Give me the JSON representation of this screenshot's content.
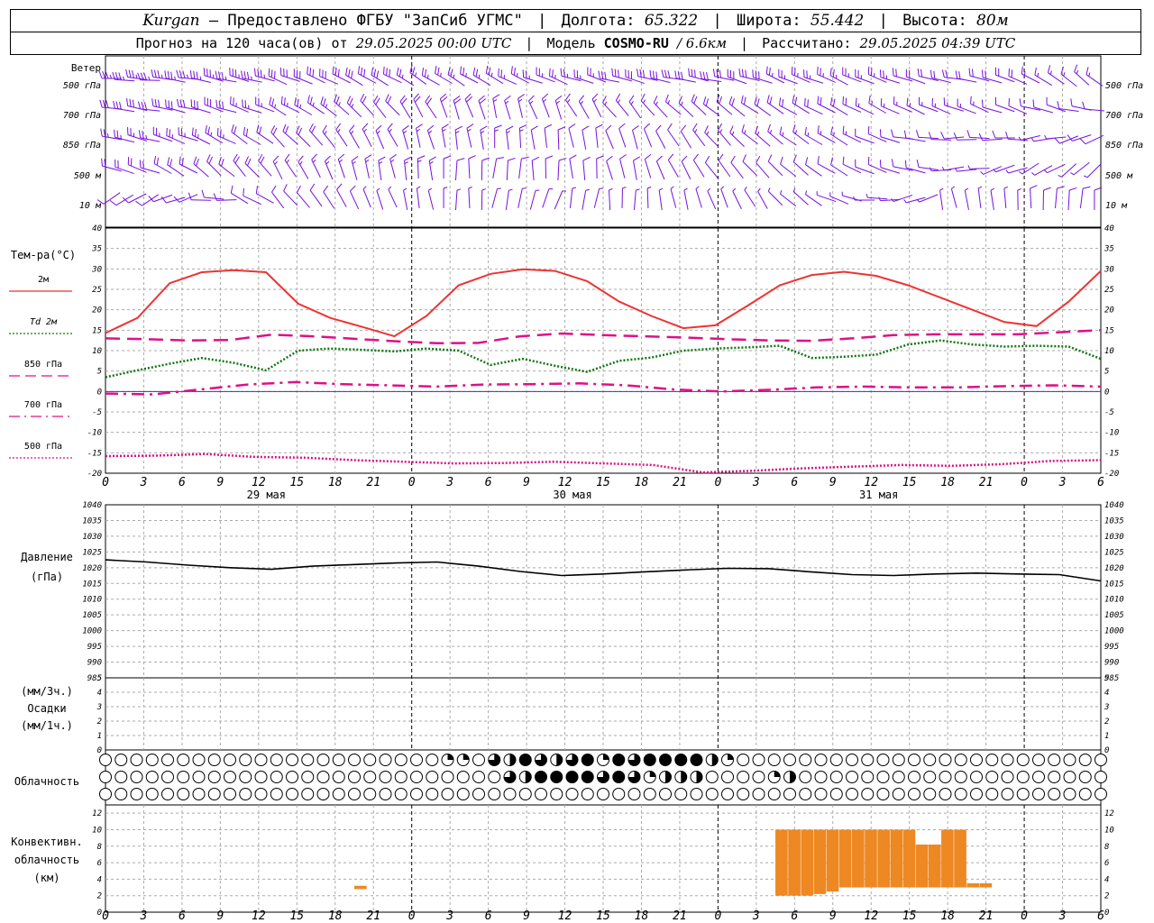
{
  "header": {
    "station": "Kurgan",
    "provider": "— Предоставлено ФГБУ \"ЗапСиб УГМС\"",
    "lon_label": "Долгота:",
    "lon_value": "65.322",
    "lat_label": "Широта:",
    "lat_value": "55.442",
    "alt_label": "Высота:",
    "alt_value": "80м",
    "forecast_label": "Прогноз на 120 часа(ов) от",
    "forecast_start": "29.05.2025 00:00 UTC",
    "model_label": "Модель",
    "model_name": "COSMO-RU",
    "model_res": "/ 6.6км",
    "calc_label": "Рассчитано:",
    "calc_time": "29.05.2025 04:39 UTC"
  },
  "colors": {
    "t2m": "#ee3333",
    "td2m": "#117711",
    "t850": "#dd1188",
    "t700": "#dd1188",
    "t500": "#dd1188",
    "zero_line": "#3333cc",
    "wind": "#7711dd",
    "pressure": "#000000",
    "convective": "#ee8822",
    "grid": "#aaaaaa"
  },
  "time_axis": {
    "hours": [
      0,
      3,
      6,
      9,
      12,
      15,
      18,
      21,
      0,
      3,
      6,
      9,
      12,
      15,
      18,
      21,
      0,
      3,
      6,
      9,
      12,
      15,
      18,
      21,
      0,
      3,
      6
    ],
    "day_labels": [
      {
        "hour_index": 4,
        "label": "29 мая"
      },
      {
        "hour_index": 12,
        "label": "30 мая"
      },
      {
        "hour_index": 20,
        "label": "31 мая"
      }
    ]
  },
  "wind_panel": {
    "title": "Ветер",
    "levels": [
      "500 гПа",
      "700 гПа",
      "850 гПа",
      "500 м",
      "10  м"
    ],
    "levels_right": [
      "500 гПа",
      "700 гПа",
      "850 гПа",
      "500 м",
      "10  м"
    ],
    "barbs": [
      {
        "dir": [
          275,
          278,
          282,
          286,
          292,
          296,
          300,
          303,
          300,
          296,
          292,
          288,
          284,
          282,
          282,
          286,
          292,
          295,
          290,
          285,
          282,
          290,
          300,
          310
        ],
        "spd": [
          35,
          35,
          35,
          35,
          30,
          30,
          30,
          25,
          25,
          25,
          25,
          25,
          30,
          30,
          30,
          30,
          25,
          25,
          25,
          20,
          20,
          20,
          15,
          15
        ]
      },
      {
        "dir": [
          280,
          282,
          286,
          292,
          300,
          310,
          320,
          330,
          340,
          345,
          340,
          330,
          320,
          315,
          310,
          305,
          300,
          298,
          296,
          292,
          292,
          290,
          285,
          280
        ],
        "spd": [
          30,
          30,
          30,
          25,
          25,
          25,
          20,
          20,
          20,
          15,
          15,
          15,
          15,
          15,
          20,
          20,
          20,
          20,
          15,
          15,
          15,
          10,
          10,
          10
        ]
      },
      {
        "dir": [
          285,
          290,
          296,
          305,
          315,
          325,
          335,
          345,
          350,
          355,
          355,
          350,
          340,
          330,
          320,
          310,
          305,
          300,
          290,
          275,
          270,
          270,
          260,
          250
        ],
        "spd": [
          25,
          25,
          25,
          20,
          20,
          15,
          15,
          15,
          15,
          15,
          10,
          10,
          10,
          10,
          15,
          15,
          15,
          15,
          10,
          10,
          10,
          10,
          5,
          10
        ]
      },
      {
        "dir": [
          290,
          300,
          310,
          320,
          330,
          340,
          350,
          355,
          0,
          5,
          0,
          355,
          345,
          335,
          325,
          318,
          310,
          300,
          290,
          280,
          265,
          250,
          240,
          230
        ],
        "spd": [
          20,
          20,
          20,
          20,
          15,
          15,
          15,
          15,
          10,
          10,
          10,
          10,
          10,
          10,
          10,
          10,
          10,
          10,
          10,
          10,
          5,
          5,
          5,
          5
        ]
      },
      {
        "dir": [
          240,
          250,
          270,
          300,
          320,
          330,
          340,
          350,
          0,
          10,
          20,
          10,
          0,
          350,
          340,
          330,
          310,
          290,
          270,
          250,
          350,
          355,
          0,
          5
        ],
        "spd": [
          10,
          10,
          10,
          10,
          10,
          10,
          5,
          5,
          5,
          5,
          5,
          5,
          5,
          5,
          5,
          5,
          5,
          5,
          5,
          5,
          5,
          5,
          10,
          10
        ]
      }
    ]
  },
  "temp_panel": {
    "title": "Тем-ра(°C)",
    "legend": [
      {
        "label": "2м",
        "style": "solid",
        "color_key": "t2m"
      },
      {
        "label": "Td 2м",
        "style": "dotted",
        "color_key": "td2m"
      },
      {
        "label": "850 гПа",
        "style": "dashed",
        "color_key": "t850"
      },
      {
        "label": "700 гПа",
        "style": "dashdot",
        "color_key": "t700"
      },
      {
        "label": "500 гПа",
        "style": "dotted",
        "color_key": "t500"
      }
    ],
    "yticks": [
      40,
      35,
      30,
      25,
      20,
      15,
      10,
      5,
      0,
      -5,
      -10,
      -15,
      -20
    ],
    "ylim": [
      -20,
      40
    ]
  },
  "pressure_panel": {
    "title": "Давление",
    "unit": "(гПа)",
    "yticks": [
      1040,
      1035,
      1030,
      1025,
      1020,
      1015,
      1010,
      1005,
      1000,
      995,
      990,
      985
    ],
    "ylim": [
      985,
      1040
    ]
  },
  "precip_panel": {
    "unit_3h": "(мм/3ч.)",
    "title": "Осадки",
    "unit_1h": "(мм/1ч.)",
    "yticks": [
      5,
      4,
      3,
      2,
      1,
      0
    ],
    "ylim": [
      0,
      5
    ]
  },
  "cloud_panel": {
    "title": "Облачность",
    "rows": [
      {
        "fraction": [
          0,
          0,
          0,
          0,
          0,
          0,
          0,
          0,
          0,
          0,
          0,
          0,
          0,
          0,
          0,
          0,
          0,
          0,
          0,
          0,
          0,
          0,
          0,
          0,
          0,
          0,
          0,
          0,
          0,
          0,
          0,
          0,
          0,
          0,
          0,
          0,
          0,
          0,
          0,
          0,
          0,
          0,
          0,
          0,
          0,
          0,
          0.5,
          0.25,
          0.25,
          0.25,
          0,
          0,
          0.5,
          0.75,
          0.25,
          0.5,
          0.5,
          0.75,
          1,
          1,
          0.75,
          0.75,
          0.5,
          1,
          0.75,
          1,
          1,
          1,
          0.25,
          1,
          1,
          1,
          1,
          0.75,
          1,
          1,
          1,
          1,
          1,
          1,
          1,
          1,
          0.25,
          0.75,
          0.5,
          0.75,
          0.25,
          0,
          0,
          0,
          0,
          0,
          0,
          0,
          0,
          0,
          0,
          0,
          0,
          0,
          0,
          0,
          0,
          0,
          0,
          0,
          0,
          0,
          0,
          0,
          0,
          0,
          0,
          0,
          0,
          0,
          0,
          0,
          0,
          0,
          0,
          0,
          0,
          0,
          0,
          0,
          0,
          0,
          0,
          0,
          0,
          0,
          0,
          0,
          0,
          0,
          0,
          0,
          0,
          0
        ]
      },
      {
        "fraction": [
          0,
          0,
          0,
          0,
          0,
          0,
          0,
          0,
          0,
          0,
          0,
          0,
          0,
          0,
          0,
          0,
          0,
          0,
          0,
          0,
          0,
          0,
          0,
          0,
          0,
          0,
          0,
          0,
          0,
          0,
          0,
          0,
          0,
          0,
          0,
          0,
          0,
          0,
          0,
          0,
          0,
          0,
          0,
          0,
          0,
          0,
          0,
          0,
          0,
          0,
          0,
          0,
          0,
          0,
          0,
          0,
          0.75,
          0.75,
          0.5,
          0.75,
          1,
          1,
          1,
          1,
          1,
          1,
          1,
          1,
          0.75,
          1,
          1,
          1,
          0.75,
          0.75,
          0.5,
          0.25,
          0.25,
          0.5,
          0.75,
          0.5,
          0.25,
          0.5,
          0,
          0,
          0,
          0,
          0,
          0,
          0,
          0,
          0,
          0.25,
          0.25,
          0.25,
          0.5,
          0,
          0,
          0,
          0,
          0,
          0,
          0,
          0,
          0,
          0,
          0,
          0,
          0,
          0,
          0,
          0,
          0,
          0,
          0,
          0,
          0,
          0,
          0,
          0,
          0,
          0,
          0,
          0,
          0,
          0,
          0,
          0,
          0,
          0,
          0,
          0,
          0,
          0,
          0,
          0,
          0,
          0,
          0,
          0,
          0
        ]
      },
      {
        "fraction": [
          0,
          0,
          0,
          0,
          0,
          0,
          0,
          0,
          0,
          0,
          0,
          0,
          0,
          0,
          0,
          0,
          0,
          0,
          0,
          0,
          0,
          0,
          0,
          0,
          0,
          0,
          0,
          0,
          0,
          0,
          0,
          0,
          0,
          0,
          0,
          0,
          0,
          0,
          0,
          0,
          0,
          0,
          0,
          0,
          0,
          0,
          0,
          0,
          0,
          0,
          0,
          0,
          0,
          0,
          0,
          0,
          0,
          0,
          0,
          0,
          0,
          0,
          0,
          0,
          0,
          0,
          0,
          0,
          0,
          0,
          0,
          0,
          0,
          0,
          0,
          0,
          0,
          0,
          0,
          0,
          0,
          0,
          0,
          0,
          0,
          0,
          0,
          0,
          0,
          0,
          0,
          0,
          0,
          0,
          0,
          0,
          0,
          0,
          0,
          0,
          0,
          0,
          0,
          0,
          0,
          0,
          0,
          0,
          0,
          0,
          0,
          0,
          0,
          0,
          0,
          0,
          0,
          0,
          0,
          0,
          0,
          0,
          0,
          0,
          0,
          0,
          0,
          0,
          0,
          0,
          0
        ]
      }
    ]
  },
  "conv_panel": {
    "title_1": "Конвективн.",
    "title_2": "облачность",
    "title_3": "(км)",
    "yticks": [
      12,
      10,
      8,
      6,
      4,
      2,
      0
    ],
    "ylim": [
      0,
      13
    ]
  },
  "chart_data": {
    "type": "line",
    "x_hours": [
      0,
      3,
      6,
      9,
      12,
      15,
      18,
      21,
      24,
      27,
      30,
      33,
      36,
      39,
      42,
      45,
      48,
      51,
      54,
      57,
      60,
      63,
      66,
      69,
      72,
      75,
      78
    ],
    "series": [
      {
        "name": "2м",
        "values": [
          14.3,
          18.0,
          26.5,
          29.2,
          29.7,
          29.2,
          21.5,
          18.0,
          15.8,
          13.5,
          18.5,
          26.0,
          28.8,
          29.9,
          29.5,
          27.0,
          22.0,
          18.5,
          15.5,
          16.2,
          21.0,
          26.0,
          28.5,
          29.3,
          28.3,
          26.0,
          23.0,
          20.0,
          17.0,
          16.0,
          22.0,
          29.5
        ]
      },
      {
        "name": "Td 2м",
        "values": [
          3.5,
          5.2,
          6.8,
          8.2,
          7.0,
          5.2,
          10.0,
          10.5,
          10.2,
          9.8,
          10.5,
          10.0,
          6.5,
          8.0,
          6.3,
          4.8,
          7.5,
          8.3,
          10.0,
          10.5,
          10.8,
          11.2,
          8.2,
          8.5,
          9.0,
          11.5,
          12.5,
          11.5,
          11.0,
          11.2,
          11.0,
          8.0
        ]
      },
      {
        "name": "850 гПа",
        "values": [
          13.0,
          12.8,
          12.5,
          12.6,
          13.9,
          13.5,
          12.9,
          12.3,
          11.8,
          11.9,
          13.5,
          14.2,
          13.8,
          13.5,
          13.2,
          12.8,
          12.5,
          12.4,
          13.0,
          13.8,
          14.0,
          14.0,
          14.0,
          14.5,
          15.0
        ]
      },
      {
        "name": "700 гПа",
        "values": [
          -0.5,
          -0.7,
          0.5,
          1.7,
          2.3,
          1.8,
          1.5,
          1.2,
          1.7,
          1.8,
          2.0,
          1.5,
          0.5,
          0.0,
          0.4,
          1.0,
          1.2,
          1.0,
          1.0,
          1.3,
          1.5,
          1.2
        ]
      },
      {
        "name": "500 гПа",
        "values": [
          -15.8,
          -15.7,
          -15.3,
          -16.0,
          -16.2,
          -16.8,
          -17.2,
          -17.6,
          -17.5,
          -17.2,
          -17.6,
          -18.0,
          -19.8,
          -19.4,
          -18.8,
          -18.4,
          -18.0,
          -18.2,
          -17.8,
          -17.0,
          -16.8
        ]
      },
      {
        "name": "Давление",
        "values": [
          1022.5,
          1021.8,
          1020.8,
          1020.0,
          1019.5,
          1020.5,
          1021.0,
          1021.5,
          1021.8,
          1020.5,
          1018.8,
          1017.5,
          1018.0,
          1018.7,
          1019.3,
          1019.8,
          1019.7,
          1018.7,
          1017.8,
          1017.5,
          1018.0,
          1018.3,
          1018.0,
          1017.8,
          1015.8
        ]
      }
    ],
    "convective": [
      {
        "hour_start": 19.5,
        "hour_end": 20.5,
        "base_km": 2.8,
        "top_km": 3.2
      },
      {
        "hour_start": 52.5,
        "hour_end": 53.5,
        "base_km": 2.0,
        "top_km": 10.0
      },
      {
        "hour_start": 53.5,
        "hour_end": 54.5,
        "base_km": 2.0,
        "top_km": 10.0
      },
      {
        "hour_start": 54.5,
        "hour_end": 55.5,
        "base_km": 2.0,
        "top_km": 10.0
      },
      {
        "hour_start": 55.5,
        "hour_end": 56.5,
        "base_km": 2.2,
        "top_km": 10.0
      },
      {
        "hour_start": 56.5,
        "hour_end": 57.5,
        "base_km": 2.5,
        "top_km": 10.0
      },
      {
        "hour_start": 57.5,
        "hour_end": 58.5,
        "base_km": 3.0,
        "top_km": 10.0
      },
      {
        "hour_start": 58.5,
        "hour_end": 59.5,
        "base_km": 3.0,
        "top_km": 10.0
      },
      {
        "hour_start": 59.5,
        "hour_end": 60.5,
        "base_km": 3.0,
        "top_km": 10.0
      },
      {
        "hour_start": 60.5,
        "hour_end": 61.5,
        "base_km": 3.0,
        "top_km": 10.0
      },
      {
        "hour_start": 61.5,
        "hour_end": 62.5,
        "base_km": 3.0,
        "top_km": 10.0
      },
      {
        "hour_start": 62.5,
        "hour_end": 63.5,
        "base_km": 3.0,
        "top_km": 10.0
      },
      {
        "hour_start": 63.5,
        "hour_end": 64.5,
        "base_km": 3.0,
        "top_km": 8.2
      },
      {
        "hour_start": 64.5,
        "hour_end": 65.5,
        "base_km": 3.0,
        "top_km": 8.2
      },
      {
        "hour_start": 65.5,
        "hour_end": 66.5,
        "base_km": 3.0,
        "top_km": 10.0
      },
      {
        "hour_start": 66.5,
        "hour_end": 67.5,
        "base_km": 3.0,
        "top_km": 10.0
      },
      {
        "hour_start": 67.5,
        "hour_end": 68.5,
        "base_km": 3.0,
        "top_km": 3.5
      },
      {
        "hour_start": 68.5,
        "hour_end": 69.5,
        "base_km": 3.0,
        "top_km": 3.5
      }
    ]
  }
}
